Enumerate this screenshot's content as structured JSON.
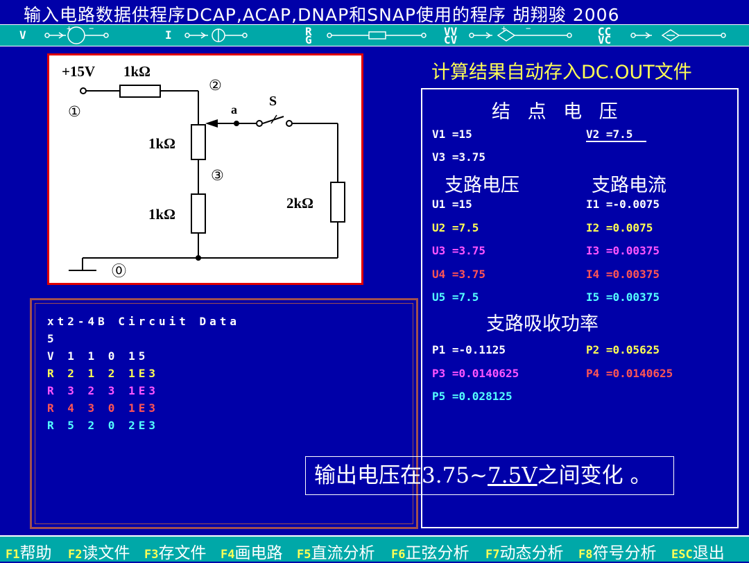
{
  "window": {
    "title": "输入电路数据供程序DCAP,ACAP,DNAP和SNAP使用的程序  胡翔骏 2006"
  },
  "toolbar": {
    "items": [
      {
        "label": "V",
        "name": "voltage-source"
      },
      {
        "label": "I",
        "name": "current-source"
      },
      {
        "label": "R\nG",
        "name": "resistor"
      },
      {
        "label": "VV\nCV",
        "name": "voltage-controlled-source"
      },
      {
        "label": "CC\nVC",
        "name": "current-controlled-source"
      }
    ]
  },
  "schematic": {
    "source_label": "+15V",
    "r1_label": "1kΩ",
    "r2_label": "1kΩ",
    "r3_label": "1kΩ",
    "r4_label": "2kΩ",
    "node0": "⓪",
    "node1": "①",
    "node2": "②",
    "node3": "③",
    "point_a": "a",
    "switch_label": "S"
  },
  "file_panel": {
    "lines": [
      {
        "text": "xt2-4B Circuit Data",
        "color": "#ffffff"
      },
      {
        "text": "5",
        "color": "#ffffff"
      },
      {
        "text": "V 1 1 0 15",
        "color": "#ffffff"
      },
      {
        "text": "R 2 1 2 1E3",
        "color": "#ffff55"
      },
      {
        "text": "R 3 2 3 1E3",
        "color": "#ff55ff"
      },
      {
        "text": "R 4 3 0 1E3",
        "color": "#ff5555"
      },
      {
        "text": "R 5 2 0 2E3",
        "color": "#55ffff"
      }
    ]
  },
  "results": {
    "heading": "计算结果自动存入DC.OUT文件",
    "node_voltage_title": "结 点 电 压",
    "V1": "V1 =15",
    "V2": "V2 =7.5",
    "V3": "V3 =3.75",
    "branch_voltage_title": "支路电压",
    "branch_current_title": "支路电流",
    "branch_rows": [
      {
        "u": "U1 =15",
        "i": "I1 =-0.0075",
        "color": "#ffffff"
      },
      {
        "u": "U2 =7.5",
        "i": "I2 =0.0075",
        "color": "#ffff55"
      },
      {
        "u": "U3 =3.75",
        "i": "I3 =0.00375",
        "color": "#ff55ff"
      },
      {
        "u": "U4 =3.75",
        "i": "I4 =0.00375",
        "color": "#ff5555"
      },
      {
        "u": "U5 =7.5",
        "i": "I5 =0.00375",
        "color": "#55ffff"
      }
    ],
    "power_title": "支路吸收功率",
    "power_rows": [
      {
        "a": "P1 =-0.1125",
        "b": "P2 =0.05625",
        "color_a": "#ffffff",
        "color_b": "#ffff55"
      },
      {
        "a": "P3 =0.0140625",
        "b": "P4 =0.0140625",
        "color_a": "#ff55ff",
        "color_b": "#ff5555"
      },
      {
        "a": "P5 =0.028125",
        "b": "",
        "color_a": "#55ffff",
        "color_b": "#ffffff"
      }
    ]
  },
  "note": {
    "prefix": "输出电压在3.75~",
    "underlined": "7.5V",
    "suffix": "之间变化 。"
  },
  "menu": {
    "items": [
      {
        "key": "F1",
        "label": "帮助"
      },
      {
        "key": "F2",
        "label": "读文件"
      },
      {
        "key": "F3",
        "label": "存文件"
      },
      {
        "key": "F4",
        "label": "画电路"
      },
      {
        "key": "F5",
        "label": "直流分析"
      },
      {
        "key": "F6",
        "label": "正弦分析"
      },
      {
        "key": "F7",
        "label": "动态分析"
      },
      {
        "key": "F8",
        "label": "符号分析"
      },
      {
        "key": "ESC",
        "label": "退出"
      }
    ]
  },
  "colors": {
    "background": "#0000a8",
    "bar": "#00a8a8",
    "heading": "#ffff55"
  }
}
